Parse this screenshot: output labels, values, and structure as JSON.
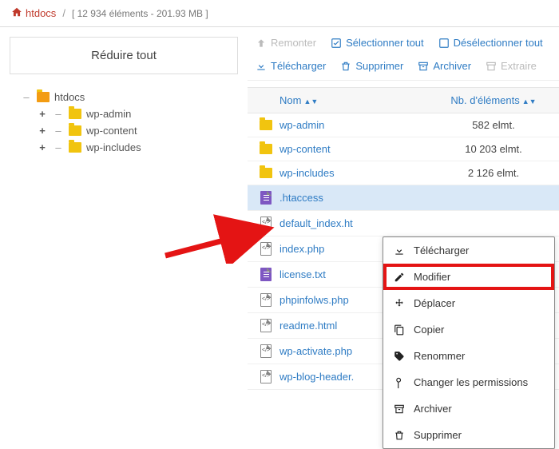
{
  "breadcrumb": {
    "root": "htdocs",
    "info": "[ 12 934 éléments - 201.93 MB ]"
  },
  "sidebar": {
    "collapse_label": "Réduire tout",
    "root": "htdocs",
    "children": [
      "wp-admin",
      "wp-content",
      "wp-includes"
    ]
  },
  "toolbar": {
    "up": "Remonter",
    "select_all": "Sélectionner tout",
    "deselect_all": "Désélectionner tout",
    "download": "Télécharger",
    "delete": "Supprimer",
    "archive": "Archiver",
    "extract": "Extraire"
  },
  "list": {
    "header_name": "Nom",
    "header_count": "Nb. d'éléments",
    "rows": [
      {
        "name": "wp-admin",
        "count": "582 elmt.",
        "type": "folder"
      },
      {
        "name": "wp-content",
        "count": "10 203 elmt.",
        "type": "folder"
      },
      {
        "name": "wp-includes",
        "count": "2 126 elmt.",
        "type": "folder"
      },
      {
        "name": ".htaccess",
        "count": "",
        "type": "file-purple",
        "selected": true
      },
      {
        "name": "default_index.ht",
        "count": "",
        "type": "file-code"
      },
      {
        "name": "index.php",
        "count": "",
        "type": "file-code"
      },
      {
        "name": "license.txt",
        "count": "",
        "type": "file-purple"
      },
      {
        "name": "phpinfolws.php",
        "count": "",
        "type": "file-code"
      },
      {
        "name": "readme.html",
        "count": "",
        "type": "file-code"
      },
      {
        "name": "wp-activate.php",
        "count": "",
        "type": "file-code"
      },
      {
        "name": "wp-blog-header.",
        "count": "",
        "type": "file-code"
      }
    ]
  },
  "context_menu": {
    "download": "Télécharger",
    "edit": "Modifier",
    "move": "Déplacer",
    "copy": "Copier",
    "rename": "Renommer",
    "permissions": "Changer les permissions",
    "archive": "Archiver",
    "delete": "Supprimer"
  }
}
